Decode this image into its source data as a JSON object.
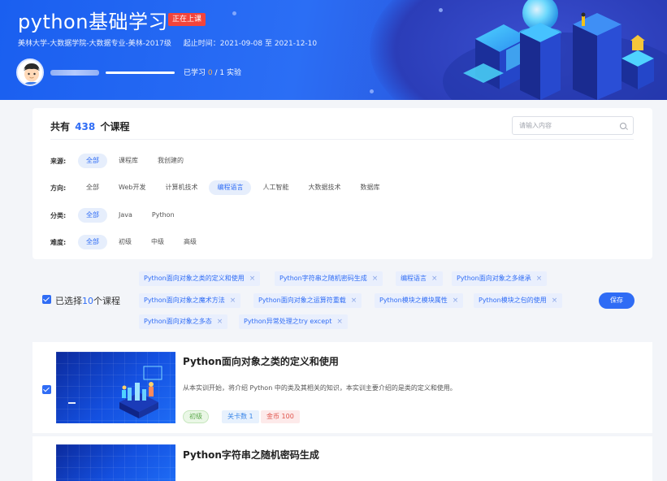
{
  "header": {
    "title": "python基础学习",
    "status_badge": "正在上课",
    "meta_class": "美林大学-大数据学院-大数据专业-美林-2017级",
    "meta_time_label": "起止时间：",
    "meta_time_value": "2021-09-08 至 2021-12-10",
    "progress_label": "已学习",
    "progress_done": "0",
    "progress_total": "/ 1 实验",
    "progress_fraction": 0.0
  },
  "filters": {
    "total_prefix": "共有",
    "total_count": "438",
    "total_suffix": "个课程",
    "search_placeholder": "请输入内容",
    "source": {
      "label": "来源:",
      "options": [
        "全部",
        "课程库",
        "我创建的"
      ],
      "active": "全部"
    },
    "direction": {
      "label": "方向:",
      "options": [
        "全部",
        "Web开发",
        "计算机技术",
        "编程语言",
        "人工智能",
        "大数据技术",
        "数据库"
      ],
      "active": "编程语言"
    },
    "category": {
      "label": "分类:",
      "options": [
        "全部",
        "Java",
        "Python"
      ],
      "active": "全部"
    },
    "difficulty": {
      "label": "难度:",
      "options": [
        "全部",
        "初级",
        "中级",
        "高级"
      ],
      "active": "全部"
    }
  },
  "selected": {
    "text_prefix": "已选择",
    "count": "10",
    "text_suffix": "个课程",
    "save_label": "保存",
    "tags": [
      "Python面向对象之类的定义和使用",
      "Python字符串之随机密码生成",
      "编程语言",
      "Python面向对象之多继承",
      "Python面向对象之魔术方法",
      "Python面向对象之运算符重载",
      "Python模块之模块属性",
      "Python模块之包的使用",
      "Python面向对象之多态",
      "Python异常处理之try except"
    ]
  },
  "courses": [
    {
      "title": "Python面向对象之类的定义和使用",
      "description": "从本实训开始，将介绍 Python 中的类及其相关的知识，本实训主要介绍的是类的定义和使用。",
      "level": "初级",
      "levels_count": "关卡数 1",
      "coins": "金币 100",
      "checked": true
    },
    {
      "title": "Python字符串之随机密码生成",
      "checked": false
    }
  ],
  "colors": {
    "accent": "#2f6cf5",
    "live": "#f3443b",
    "banner": "#2b6ef5"
  }
}
